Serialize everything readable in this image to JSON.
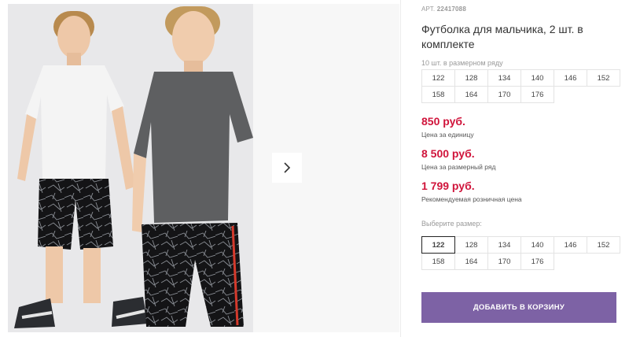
{
  "product": {
    "sku_label": "АРТ.",
    "sku": "22417088",
    "title": "Футболка для мальчика, 2 шт. в комплекте",
    "size_range_note": "10 шт. в размерном ряду",
    "size_range": [
      "122",
      "128",
      "134",
      "140",
      "146",
      "152",
      "158",
      "164",
      "170",
      "176"
    ]
  },
  "prices": [
    {
      "value": "850 руб.",
      "label": "Цена за единицу"
    },
    {
      "value": "8 500 руб.",
      "label": "Цена за размерный ряд"
    },
    {
      "value": "1 799 руб.",
      "label": "Рекомендуемая розничная цена"
    }
  ],
  "size_selector": {
    "label": "Выберите размер:",
    "selected": "122",
    "options": [
      "122",
      "128",
      "134",
      "140",
      "146",
      "152",
      "158",
      "164",
      "170",
      "176"
    ]
  },
  "cart_button": "ДОБАВИТЬ В КОРЗИНУ",
  "gallery": {
    "next_icon": "chevron-right-icon"
  },
  "colors": {
    "price": "#d0143b",
    "button": "#7d62a5",
    "tshirt_white": "#f4f4f4",
    "tshirt_gray": "#5e5f61"
  }
}
